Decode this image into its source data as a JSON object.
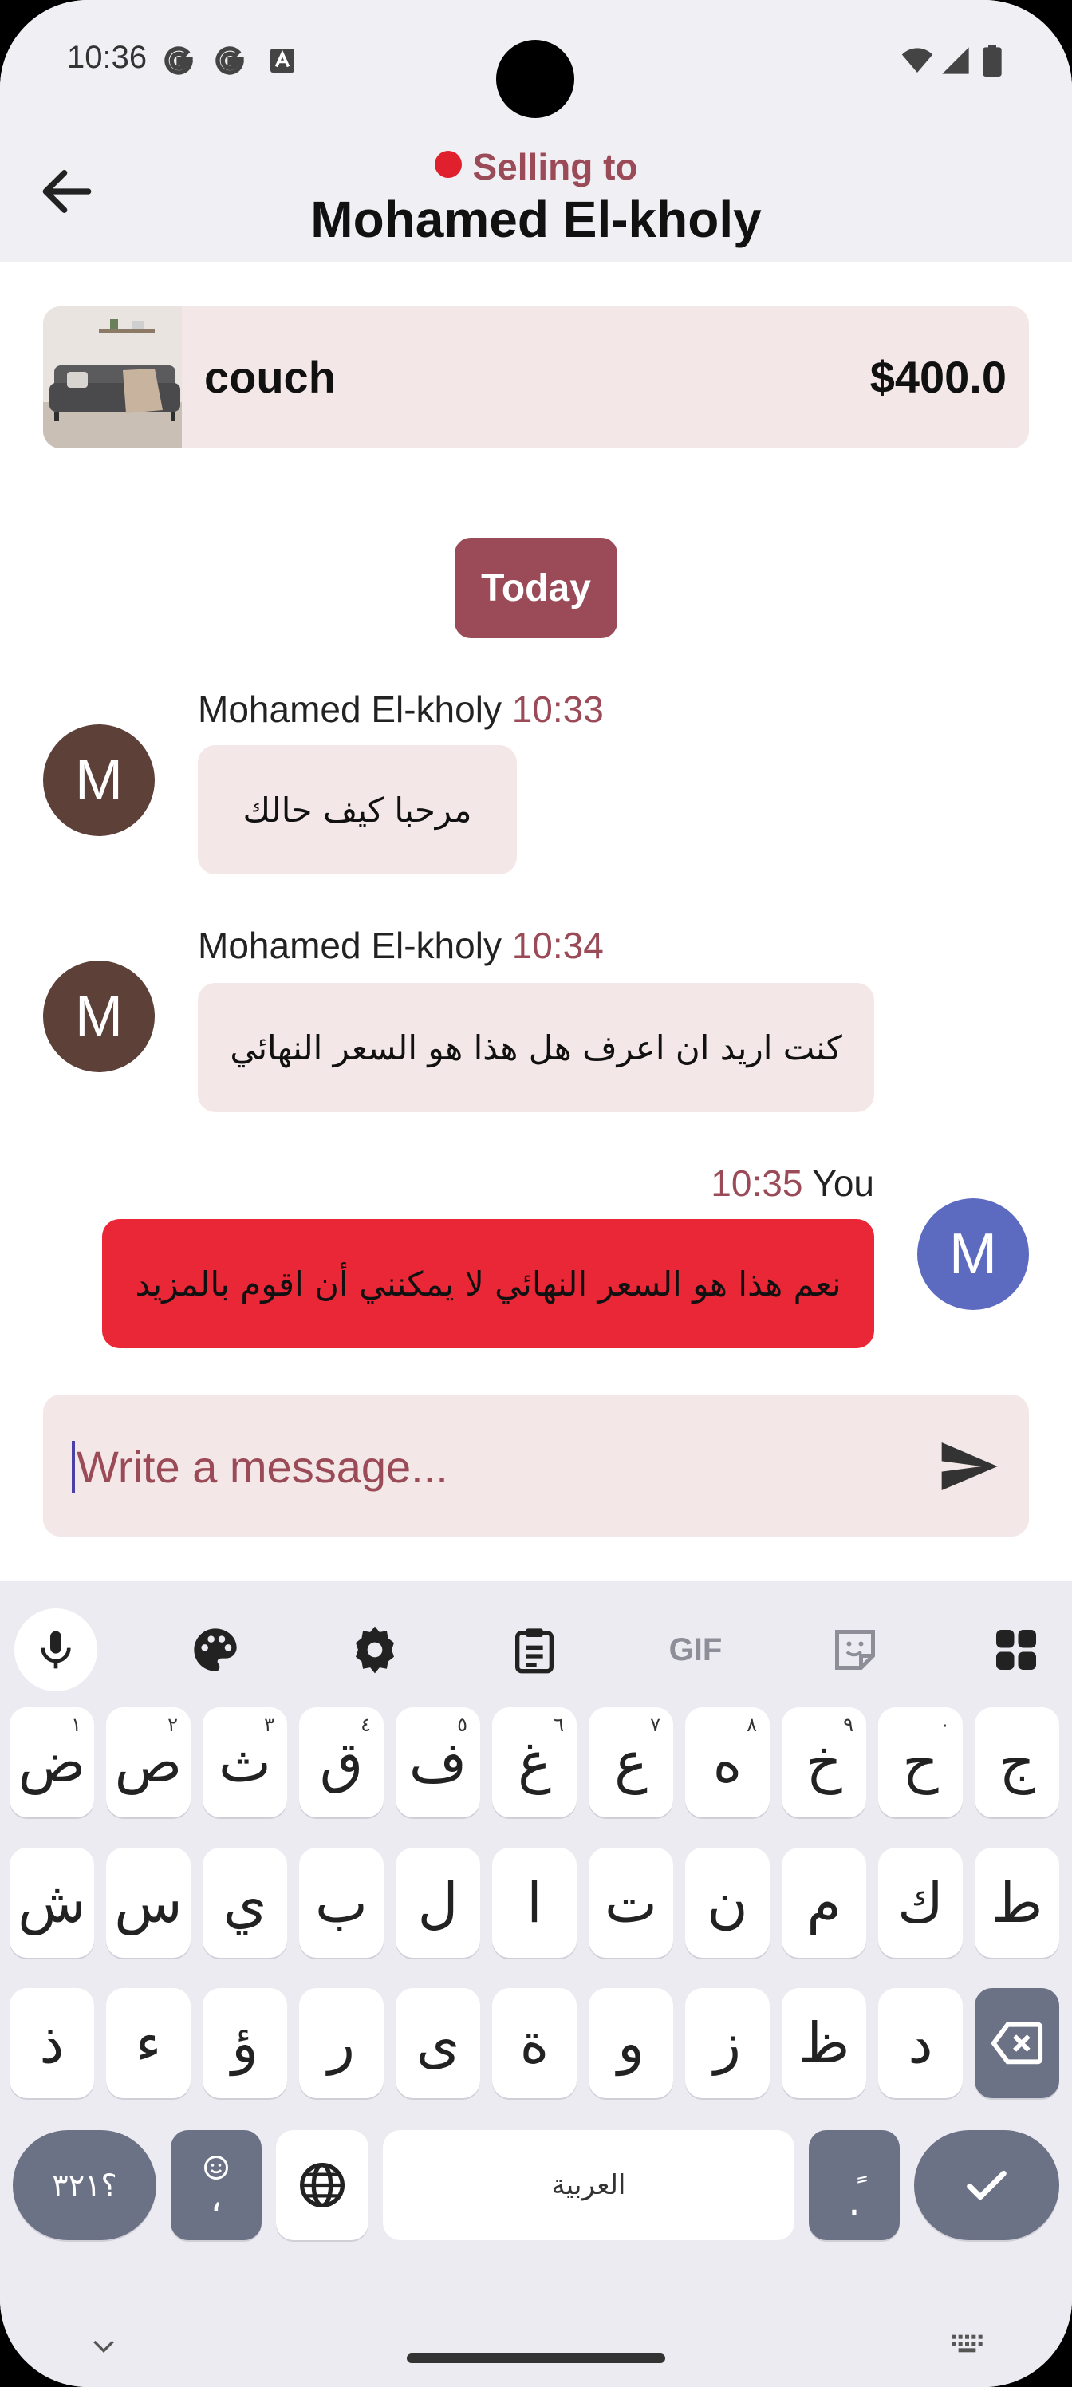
{
  "status_bar": {
    "time": "10:36",
    "notification_icons": [
      "google-g-icon",
      "google-g-icon",
      "font-a-icon"
    ],
    "system_icons": [
      "wifi-icon",
      "signal-icon",
      "battery-icon"
    ]
  },
  "app_bar": {
    "back_icon": "arrow-left-icon",
    "status_label": "Selling to",
    "status_color": "#e0202d",
    "title": "Mohamed El-kholy"
  },
  "item": {
    "name": "couch",
    "price": "$400.0"
  },
  "date_chip": "Today",
  "messages": [
    {
      "sender": "Mohamed El-kholy",
      "time": "10:33",
      "avatar_letter": "M",
      "text": "مرحبا كيف حالك",
      "from_me": false
    },
    {
      "sender": "Mohamed El-kholy",
      "time": "10:34",
      "avatar_letter": "M",
      "text": "كنت اريد ان اعرف هل هذا هو السعر النهائي",
      "from_me": false
    },
    {
      "sender": "You",
      "time": "10:35",
      "avatar_letter": "M",
      "text": "نعم هذا هو السعر النهائي لا يمكنني أن اقوم بالمزيد",
      "from_me": true
    }
  ],
  "composer": {
    "placeholder": "Write a message...",
    "send_icon": "send-icon"
  },
  "keyboard": {
    "toolbar": [
      "mic-icon",
      "palette-icon",
      "settings-icon",
      "clipboard-icon",
      "gif-icon",
      "sticker-icon",
      "apps-grid-icon"
    ],
    "gif_label": "GIF",
    "row1": [
      "ض",
      "ص",
      "ث",
      "ق",
      "ف",
      "غ",
      "ع",
      "ه",
      "خ",
      "ح",
      "ج"
    ],
    "row1_hints": [
      "١",
      "٢",
      "٣",
      "٤",
      "٥",
      "٦",
      "٧",
      "٨",
      "٩",
      "٠",
      ""
    ],
    "row2": [
      "ش",
      "س",
      "ي",
      "ب",
      "ل",
      "ا",
      "ت",
      "ن",
      "م",
      "ك",
      "ط"
    ],
    "row3": [
      "ذ",
      "ء",
      "ؤ",
      "ر",
      "ى",
      "ة",
      "و",
      "ز",
      "ظ",
      "د"
    ],
    "symbols_key": "؟٣٢١",
    "emoji_comma_key": "،",
    "space_label": "العربية",
    "period_key": ".",
    "period_hint": "ٍ",
    "colors": {
      "background": "#ecebf2",
      "dark_key": "#6b7286"
    }
  },
  "colors": {
    "accent": "#9b4b57",
    "my_bubble": "#e92736",
    "other_bubble": "#f3e7e7",
    "other_avatar": "#5d4038",
    "my_avatar": "#5c6bc0"
  }
}
